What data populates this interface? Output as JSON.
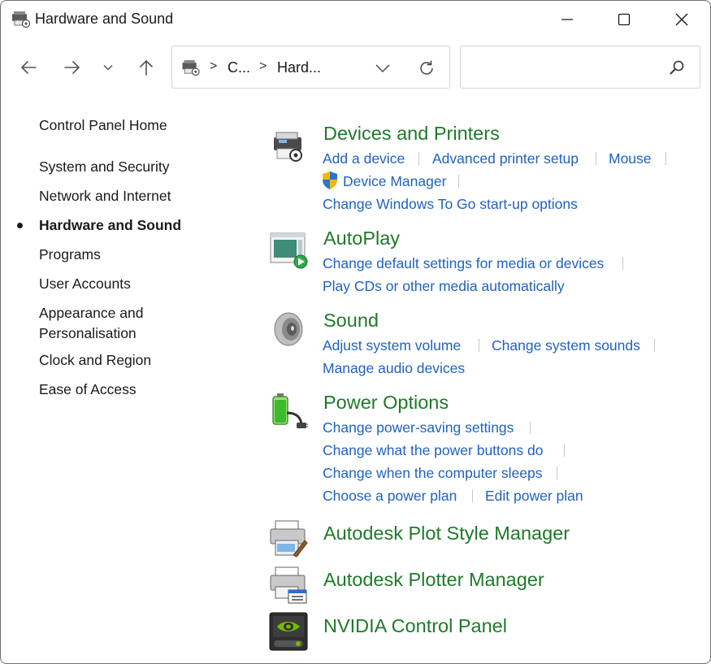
{
  "window": {
    "title": "Hardware and Sound",
    "title_icon": "control-panel-icon"
  },
  "nav": {
    "back_icon": "arrow-left-icon",
    "forward_icon": "arrow-right-icon",
    "recent_icon": "chevron-down-icon",
    "up_icon": "arrow-up-icon"
  },
  "address": {
    "crumbs": [
      "C...",
      "Hard..."
    ],
    "separator": ">"
  },
  "search": {
    "value": "",
    "placeholder": ""
  },
  "sidebar": {
    "items": [
      {
        "label": "Control Panel Home"
      },
      {
        "label": "System and Security"
      },
      {
        "label": "Network and Internet"
      },
      {
        "label": "Hardware and Sound",
        "current": true
      },
      {
        "label": "Programs"
      },
      {
        "label": "User Accounts"
      },
      {
        "label": "Appearance and"
      },
      {
        "label": "Personalisation"
      },
      {
        "label": "Clock and Region"
      },
      {
        "label": "Ease of Access"
      }
    ]
  },
  "categories": [
    {
      "title": "Devices and Printers",
      "icon": "printer-icon",
      "links": [
        "Add a device",
        "Advanced printer setup",
        "Mouse",
        "Device Manager",
        "Change Windows To Go start-up options"
      ]
    },
    {
      "title": "AutoPlay",
      "icon": "autoplay-icon",
      "links": [
        "Change default settings for media or devices",
        "Play CDs or other media automatically"
      ]
    },
    {
      "title": "Sound",
      "icon": "speaker-icon",
      "links": [
        "Adjust system volume",
        "Change system sounds",
        "Manage audio devices"
      ]
    },
    {
      "title": "Power Options",
      "icon": "battery-icon",
      "links": [
        "Change power-saving settings",
        "Change what the power buttons do",
        "Change when the computer sleeps",
        "Choose a power plan",
        "Edit power plan"
      ]
    },
    {
      "title": "Autodesk Plot Style Manager",
      "icon": "plot-style-icon",
      "links": []
    },
    {
      "title": "Autodesk Plotter Manager",
      "icon": "plotter-icon",
      "links": []
    },
    {
      "title": "NVIDIA Control Panel",
      "icon": "nvidia-icon",
      "links": []
    }
  ],
  "colors": {
    "category_title": "#1e7a28",
    "link": "#1f62c2",
    "text": "#1a1a1a"
  }
}
